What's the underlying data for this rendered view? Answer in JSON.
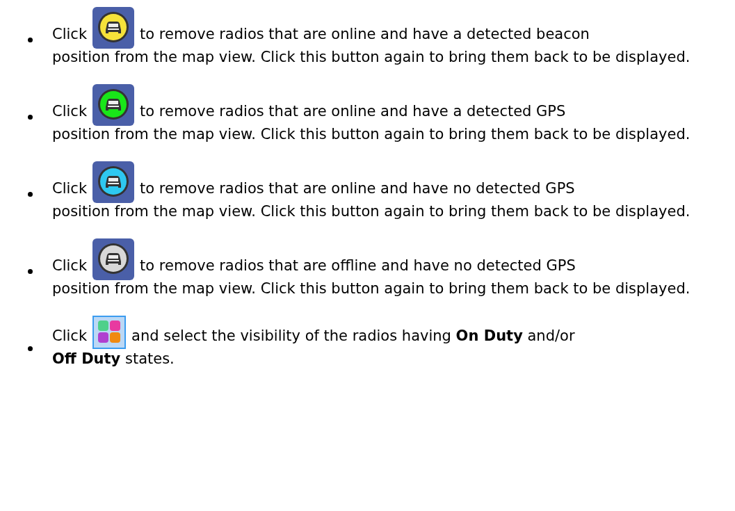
{
  "items": [
    {
      "before": "Click",
      "icon": {
        "kind": "car",
        "color": "#f5e23a"
      },
      "after_first": "to remove radios that are online and have a detected beacon",
      "after_rest": "position from the map view. Click this button again to bring them back to be displayed."
    },
    {
      "before": "Click",
      "icon": {
        "kind": "car",
        "color": "#19e619"
      },
      "after_first": "to remove radios that are online and have a detected GPS",
      "after_rest": "position from the map view. Click this button again to bring them back to be displayed."
    },
    {
      "before": "Click",
      "icon": {
        "kind": "car",
        "color": "#2ec8f0"
      },
      "after_first": "to remove radios that are online and have no detected GPS",
      "after_rest": "position from the map view. Click this button again to bring them back to be displayed."
    },
    {
      "before": "Click",
      "icon": {
        "kind": "car",
        "color": "#d8d8d8"
      },
      "after_first": "to remove radios that are offline and have no detected GPS",
      "after_rest": "position from the map view. Click this button again to bring them back to be displayed."
    },
    {
      "before": "Click",
      "icon": {
        "kind": "tiles"
      },
      "after_first": "and select the visibility of the radios having **On Duty** and/or",
      "after_rest": "**Off Duty** states."
    }
  ]
}
